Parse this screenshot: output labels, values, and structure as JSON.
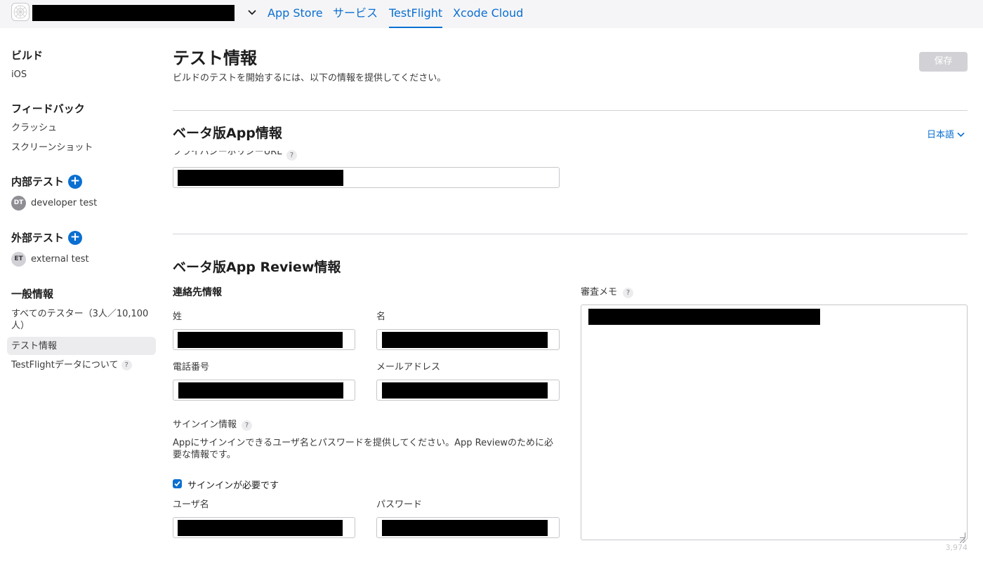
{
  "topbar": {
    "app_icon": "app-placeholder-icon",
    "switcher_icon": "chevron-down-icon",
    "tabs": [
      "App Store",
      "サービス",
      "TestFlight",
      "Xcode Cloud"
    ],
    "active_tab": "TestFlight",
    "accent_color": "#0a6fd1"
  },
  "sidebar": {
    "builds": {
      "heading": "ビルド",
      "items": [
        "iOS"
      ]
    },
    "feedback": {
      "heading": "フィードバック",
      "items": [
        "クラッシュ",
        "スクリーンショット"
      ]
    },
    "internal": {
      "heading": "内部テスト",
      "add_icon": "plus-circle-icon",
      "groups": [
        {
          "initials": "DT",
          "name": "developer test"
        }
      ]
    },
    "external": {
      "heading": "外部テスト",
      "add_icon": "plus-circle-icon",
      "groups": [
        {
          "initials": "ET",
          "name": "external test"
        }
      ]
    },
    "general": {
      "heading": "一般情報",
      "all_testers": "すべてのテスター（3人／10,100人）",
      "test_info": "テスト情報",
      "testflight_data": "TestFlightデータについて"
    }
  },
  "main": {
    "title": "テスト情報",
    "subtitle": "ビルドのテストを開始するには、以下の情報を提供してください。",
    "save_label": "保存",
    "beta_app_info": {
      "title": "ベータ版App情報",
      "language": "日本語",
      "privacy_policy_label": "プライバシーポリシーURL"
    },
    "beta_review": {
      "title": "ベータ版App Review情報",
      "contact_heading": "連絡先情報",
      "last_name_label": "姓",
      "first_name_label": "名",
      "phone_label": "電話番号",
      "email_label": "メールアドレス",
      "signin_label": "サインイン情報",
      "signin_desc": "Appにサインインできるユーザ名とパスワードを提供してください。App Reviewのために必要な情報です。",
      "signin_required_label": "サインインが必要です",
      "signin_required": true,
      "username_label": "ユーザ名",
      "password_label": "パスワード",
      "review_notes_label": "審査メモ",
      "char_remaining": "3,974"
    },
    "help_icon": "question-mark-icon",
    "help_glyph": "?"
  }
}
